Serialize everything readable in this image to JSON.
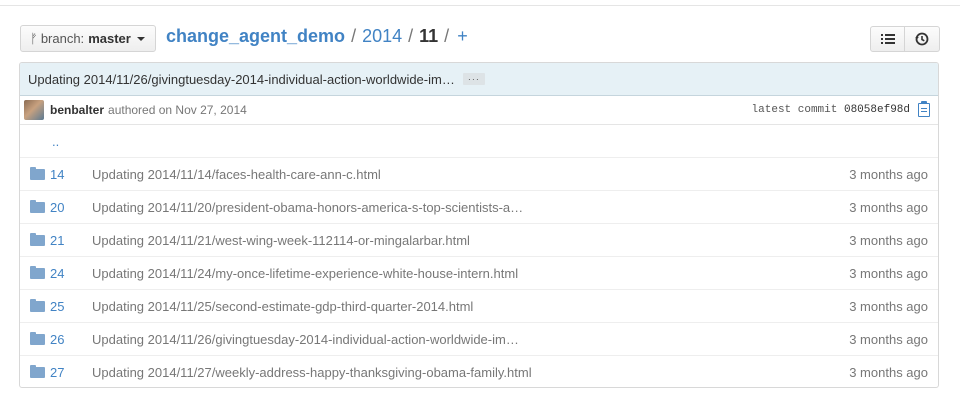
{
  "branch": {
    "prefix": "branch:",
    "name": "master"
  },
  "breadcrumb": {
    "repo": "change_agent_demo",
    "sep1": "/",
    "year": "2014",
    "sep2": "/",
    "current": "11",
    "sep3": "/",
    "plus": "+"
  },
  "toolbar": {
    "list_icon": "list-icon",
    "history_icon": "history-icon"
  },
  "commit": {
    "message": "Updating 2014/11/26/givingtuesday-2014-individual-action-worldwide-im…",
    "ellipsis": "···",
    "author": "benbalter",
    "authored": "authored on Nov 27, 2014",
    "latest_label": "latest commit",
    "sha": "08058ef98d"
  },
  "up_dir": "..",
  "files": [
    {
      "name": "14",
      "message": "Updating 2014/11/14/faces-health-care-ann-c.html",
      "age": "3 months ago"
    },
    {
      "name": "20",
      "message": "Updating 2014/11/20/president-obama-honors-america-s-top-scientists-a…",
      "age": "3 months ago"
    },
    {
      "name": "21",
      "message": "Updating 2014/11/21/west-wing-week-112114-or-mingalarbar.html",
      "age": "3 months ago"
    },
    {
      "name": "24",
      "message": "Updating 2014/11/24/my-once-lifetime-experience-white-house-intern.html",
      "age": "3 months ago"
    },
    {
      "name": "25",
      "message": "Updating 2014/11/25/second-estimate-gdp-third-quarter-2014.html",
      "age": "3 months ago"
    },
    {
      "name": "26",
      "message": "Updating 2014/11/26/givingtuesday-2014-individual-action-worldwide-im…",
      "age": "3 months ago"
    },
    {
      "name": "27",
      "message": "Updating 2014/11/27/weekly-address-happy-thanksgiving-obama-family.html",
      "age": "3 months ago"
    }
  ],
  "colors": {
    "link": "#4183c4",
    "commit_bar": "#e6f1f6",
    "folder": "#80a6cd"
  }
}
